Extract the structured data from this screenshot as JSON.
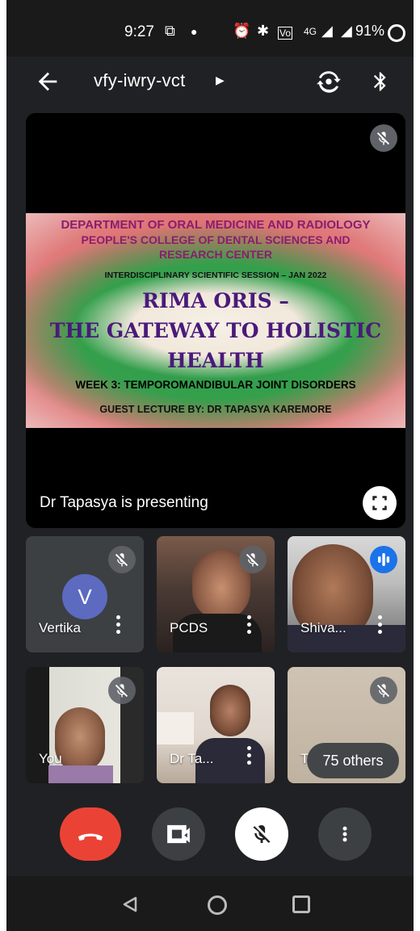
{
  "status_bar": {
    "time": "9:27",
    "battery": "91%",
    "network": "4G"
  },
  "app_bar": {
    "meeting_code": "vfy-iwry-vct"
  },
  "stage": {
    "slide": {
      "department": "DEPARTMENT OF ORAL MEDICINE AND RADIOLOGY",
      "college": "PEOPLE'S COLLEGE OF DENTAL SCIENCES AND",
      "center": "RESEARCH CENTER",
      "session": "INTERDISCIPLINARY SCIENTIFIC SESSION – JAN 2022",
      "title_line1": "RIMA ORIS –",
      "title_line2": "THE GATEWAY TO HOLISTIC",
      "title_line3": "HEALTH",
      "week": "WEEK 3: TEMPOROMANDIBULAR JOINT DISORDERS",
      "guest": "GUEST LECTURE BY: DR TAPASYA KAREMORE"
    },
    "presenting_text": "Dr Tapasya is presenting"
  },
  "participants": [
    {
      "name": "Vertika",
      "avatar_letter": "V",
      "muted": true
    },
    {
      "name": "PCDS",
      "muted": true
    },
    {
      "name": "Shiva...",
      "speaking": true
    },
    {
      "name": "You",
      "muted": true
    },
    {
      "name": "Dr Ta..."
    },
    {
      "name": "T",
      "others_label": "75 others",
      "muted": true
    }
  ],
  "colors": {
    "end_call": "#ea4335",
    "avatar_bg": "#5c6bc0",
    "speaking": "#1a73e8",
    "background": "#202124"
  }
}
